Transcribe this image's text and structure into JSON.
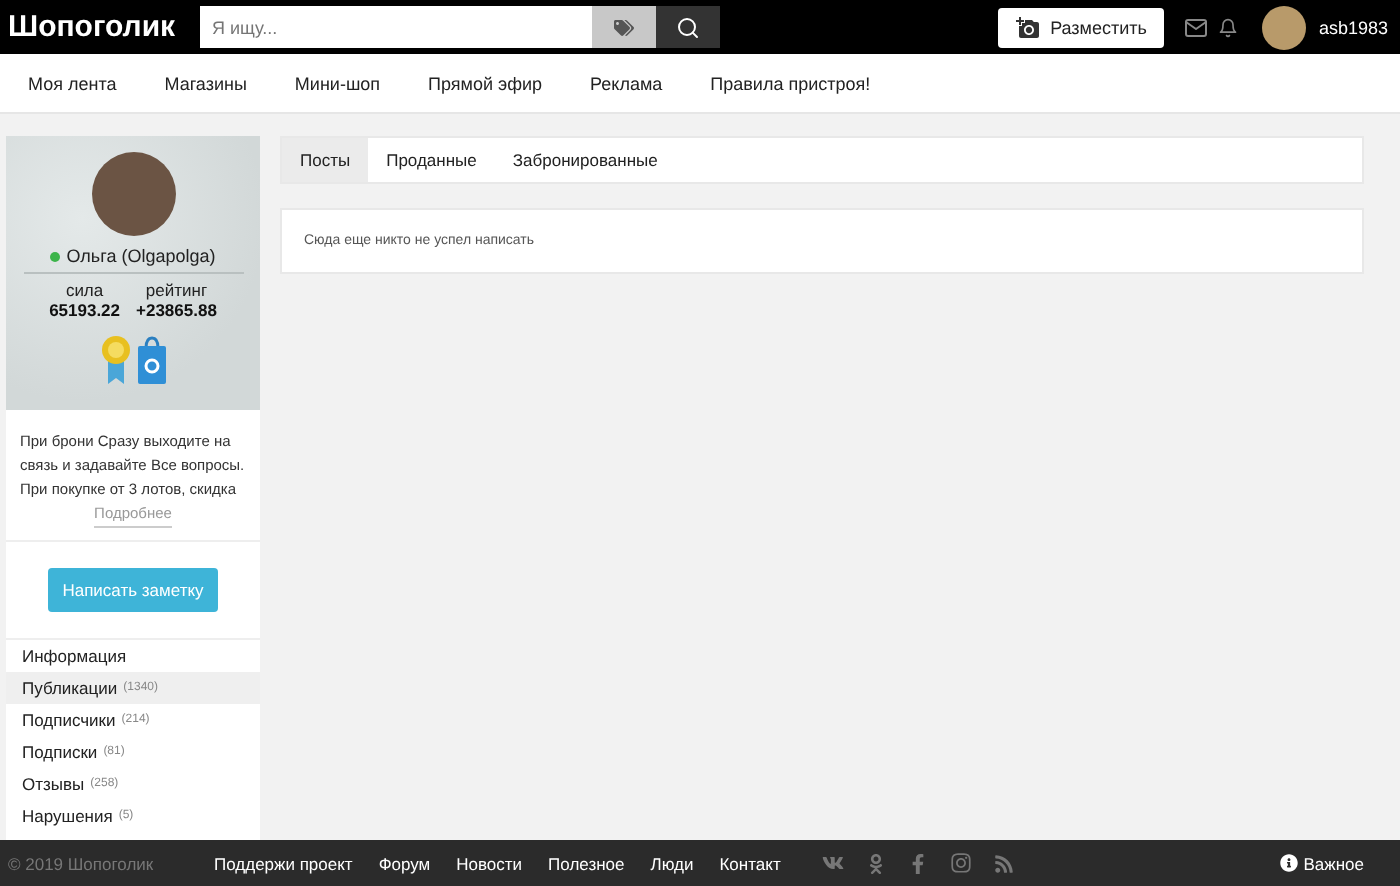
{
  "header": {
    "logo": "Шопоголик",
    "search": {
      "placeholder": "Я ищу..."
    },
    "post_button": "Разместить",
    "username": "asb1983"
  },
  "nav": [
    "Моя лента",
    "Магазины",
    "Мини-шоп",
    "Прямой эфир",
    "Реклама",
    "Правила пристроя!"
  ],
  "profile": {
    "name": "Ольга (Olgapolga)",
    "online": true,
    "stats": [
      {
        "label": "сила",
        "value": "65193.22"
      },
      {
        "label": "рейтинг",
        "value": "+23865.88"
      }
    ],
    "bio": "При брони Сразу выходите на связь и задавайте Все вопросы. При покупке от 3 лотов, скидка",
    "more_link": "Подробнее",
    "note_button": "Написать заметку"
  },
  "menu": [
    {
      "label": "Информация",
      "selected": false
    },
    {
      "label": "Публикации",
      "count": "(1340)",
      "selected": true
    },
    {
      "label": "Подписчики",
      "count": "(214)",
      "selected": false
    },
    {
      "label": "Подписки",
      "count": "(81)",
      "selected": false
    },
    {
      "label": "Отзывы",
      "count": "(258)",
      "selected": false
    },
    {
      "label": "Нарушения",
      "count": "(5)",
      "selected": false
    }
  ],
  "tabs": [
    {
      "label": "Посты",
      "selected": true
    },
    {
      "label": "Проданные",
      "selected": false
    },
    {
      "label": "Забронированные",
      "selected": false
    }
  ],
  "empty_message": "Сюда еще никто не успел написать",
  "footer": {
    "copyright": "© 2019 Шопоголик",
    "links": [
      "Поддержи проект",
      "Форум",
      "Новости",
      "Полезное",
      "Люди",
      "Контакт"
    ],
    "important": "Важное"
  }
}
